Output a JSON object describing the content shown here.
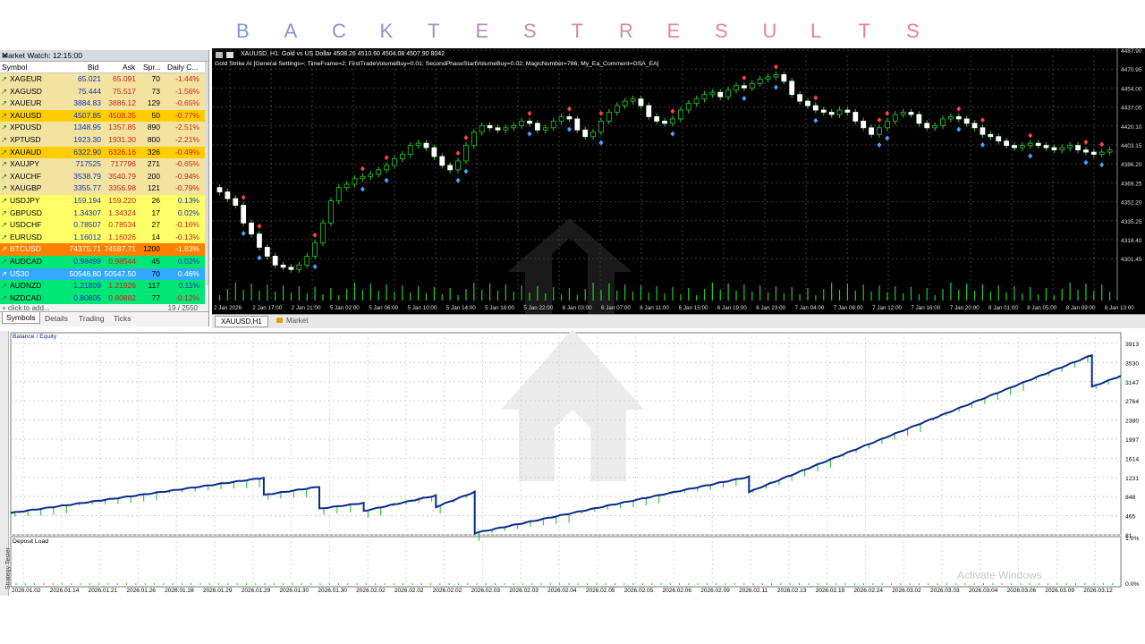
{
  "banner": {
    "letters": [
      "B",
      "A",
      "C",
      "K",
      "T",
      "E",
      "S",
      "T",
      "R",
      "E",
      "S",
      "U",
      "L",
      "T",
      "S"
    ],
    "colors": [
      "#7c9bd3",
      "#8596d0",
      "#8c92cc",
      "#9a8ec8",
      "#a98cc4",
      "#b88ac0",
      "#c48abc",
      "#ce88b6",
      "#d688b0",
      "#de86a8",
      "#e484a2",
      "#e8829c",
      "#ec8096",
      "#ef7e90",
      "#f27c8a"
    ]
  },
  "market_watch": {
    "title": "Market Watch: 12:15:00",
    "close": "✕",
    "headers": {
      "symbol": "Symbol",
      "bid": "Bid",
      "ask": "Ask",
      "spread": "Spr...",
      "change": "Daily C..."
    },
    "rows": [
      {
        "symbol": "XAGEUR",
        "bid": "65.021",
        "ask": "65.091",
        "spread": "70",
        "change": "-1.44%",
        "bg": "#f3e3a1",
        "dir": "up"
      },
      {
        "symbol": "XAGUSD",
        "bid": "75.444",
        "ask": "75.517",
        "spread": "73",
        "change": "-1.56%",
        "bg": "#f3e3a1",
        "dir": "up"
      },
      {
        "symbol": "XAUEUR",
        "bid": "3884.83",
        "ask": "3886.12",
        "spread": "129",
        "change": "-0.65%",
        "bg": "#f3e3a1",
        "dir": "up"
      },
      {
        "symbol": "XAUUSD",
        "bid": "4507.85",
        "ask": "4508.35",
        "spread": "50",
        "change": "-0.77%",
        "bg": "#ffcc00",
        "dir": "up"
      },
      {
        "symbol": "XPDUSD",
        "bid": "1348.95",
        "ask": "1357.85",
        "spread": "890",
        "change": "-2.51%",
        "bg": "#f3e3a1",
        "dir": "up"
      },
      {
        "symbol": "XPTUSD",
        "bid": "1923.30",
        "ask": "1931.30",
        "spread": "800",
        "change": "-2.21%",
        "bg": "#f3e3a1",
        "dir": "up"
      },
      {
        "symbol": "XAUAUD",
        "bid": "6322.90",
        "ask": "6326.16",
        "spread": "326",
        "change": "-0.49%",
        "bg": "#ffcc00",
        "dir": "up"
      },
      {
        "symbol": "XAUJPY",
        "bid": "717525",
        "ask": "717796",
        "spread": "271",
        "change": "-0.65%",
        "bg": "#f3e3a1",
        "dir": "up"
      },
      {
        "symbol": "XAUCHF",
        "bid": "3538.79",
        "ask": "3540.79",
        "spread": "200",
        "change": "-0.94%",
        "bg": "#f3e3a1",
        "dir": "up"
      },
      {
        "symbol": "XAUGBP",
        "bid": "3355.77",
        "ask": "3356.98",
        "spread": "121",
        "change": "-0.79%",
        "bg": "#f3e3a1",
        "dir": "up"
      },
      {
        "symbol": "USDJPY",
        "bid": "159.194",
        "ask": "159.220",
        "spread": "26",
        "change": "0.13%",
        "bg": "#ffff66",
        "dir": "up"
      },
      {
        "symbol": "GBPUSD",
        "bid": "1.34307",
        "ask": "1.34324",
        "spread": "17",
        "change": "0.02%",
        "bg": "#ffff66",
        "dir": "up"
      },
      {
        "symbol": "USDCHF",
        "bid": "0.78507",
        "ask": "0.78534",
        "spread": "27",
        "change": "-0.16%",
        "bg": "#ffff66",
        "dir": "up"
      },
      {
        "symbol": "EURUSD",
        "bid": "1.16012",
        "ask": "1.16026",
        "spread": "14",
        "change": "-0.13%",
        "bg": "#ffff66",
        "dir": "up"
      },
      {
        "symbol": "BTCUSD",
        "bid": "74375.71",
        "ask": "74587.71",
        "spread": "1200",
        "change": "-1.83%",
        "bg": "#ff8000",
        "dir": "up"
      },
      {
        "symbol": "AUDCAD",
        "bid": "0.98499",
        "ask": "0.98544",
        "spread": "45",
        "change": "0.02%",
        "bg": "#00e676",
        "dir": "up"
      },
      {
        "symbol": "US30",
        "bid": "50546.80",
        "ask": "50547.50",
        "spread": "70",
        "change": "0.46%",
        "bg": "#33aaff",
        "dir": "up"
      },
      {
        "symbol": "AUDNZD",
        "bid": "1.21809",
        "ask": "1.21926",
        "spread": "117",
        "change": "0.11%",
        "bg": "#00e676",
        "dir": "up"
      },
      {
        "symbol": "NZDCAD",
        "bid": "0.80805",
        "ask": "0.80882",
        "spread": "77",
        "change": "-0.12%",
        "bg": "#00e676",
        "dir": "up"
      }
    ],
    "add_label": "+ click to add...",
    "count": "19 / 2550",
    "tabs": [
      "Symbols",
      "Details",
      "Trading",
      "Ticks"
    ]
  },
  "price_chart": {
    "info_line1": "XAUUSD, H1:  Gold vs US Dollar  4508.26  4510.60  4504.08  4507.90  8042",
    "info_line2": "Gold Strike AI [General Settings=; TimeFrame=2; FirstTradeVolumeBuy=0.01; SecondPhaseStartVolumeBuy=0.02; MagicNumber=786; My_Ea_Comment=GSA_EA]",
    "y_labels": [
      "4487.90",
      "4470.95",
      "4454.00",
      "4437.05",
      "4420.10",
      "4403.15",
      "4386.20",
      "4369.25",
      "4352.20",
      "4335.25",
      "4318.40",
      "4301.45"
    ],
    "x_labels": [
      "2 Jan 2026",
      "2 Jan 17:00",
      "2 Jan 21:00",
      "5 Jan 02:00",
      "5 Jan 06:00",
      "5 Jan 10:00",
      "5 Jan 14:00",
      "5 Jan 18:00",
      "5 Jan 22:00",
      "6 Jan 03:00",
      "6 Jan 07:00",
      "6 Jan 11:00",
      "6 Jan 15:00",
      "6 Jan 19:00",
      "6 Jan 23:00",
      "7 Jan 04:00",
      "7 Jan 08:00",
      "7 Jan 12:00",
      "7 Jan 16:00",
      "7 Jan 20:00",
      "8 Jan 01:00",
      "8 Jan 05:00",
      "8 Jan 09:00",
      "8 Jan 13:00"
    ],
    "closes": [
      4388,
      4382,
      4376,
      4360,
      4350,
      4338,
      4330,
      4322,
      4320,
      4318,
      4322,
      4330,
      4342,
      4360,
      4380,
      4392,
      4395,
      4400,
      4402,
      4404,
      4408,
      4412,
      4418,
      4422,
      4430,
      4432,
      4428,
      4420,
      4412,
      4408,
      4416,
      4430,
      4442,
      4448,
      4446,
      4444,
      4446,
      4448,
      4452,
      4450,
      4444,
      4446,
      4452,
      4456,
      4454,
      4444,
      4438,
      4442,
      4452,
      4460,
      4466,
      4470,
      4472,
      4466,
      4456,
      4452,
      4450,
      4454,
      4462,
      4468,
      4472,
      4476,
      4478,
      4474,
      4480,
      4484,
      4482,
      4486,
      4490,
      4492,
      4494,
      4488,
      4476,
      4470,
      4466,
      4462,
      4460,
      4458,
      4462,
      4460,
      4452,
      4446,
      4440,
      4446,
      4452,
      4458,
      4460,
      4458,
      4450,
      4446,
      4448,
      4454,
      4456,
      4454,
      4450,
      4446,
      4440,
      4438,
      4434,
      4430,
      4428,
      4430,
      4432,
      4430,
      4428,
      4426,
      4428,
      4430,
      4426,
      4424,
      4422,
      4424,
      4426
    ],
    "tabs": [
      "XAUUSD,H1",
      "Market"
    ]
  },
  "tester": {
    "label_top": "Balance / Equity",
    "label_bottom": "Deposit Load",
    "side_label": "Strategy Tester",
    "y_labels": [
      "3913",
      "3530",
      "3147",
      "2764",
      "2380",
      "1997",
      "1614",
      "1231",
      "848",
      "465",
      "81"
    ],
    "y_labels2": [
      "1.0%",
      "0.0%"
    ],
    "x_labels": [
      "2026.01.02",
      "2026.01.14",
      "2026.01.21",
      "2026.01.26",
      "2026.01.28",
      "2026.01.29",
      "2026.01.29",
      "2026.01.30",
      "2026.01.30",
      "2026.02.02",
      "2026.02.02",
      "2026.02.02",
      "2026.02.03",
      "2026.02.03",
      "2026.02.04",
      "2026.02.05",
      "2026.02.05",
      "2026.02.06",
      "2026.02.09",
      "2026.02.11",
      "2026.02.13",
      "2026.02.19",
      "2026.02.24",
      "2026.03.02",
      "2026.03.03",
      "2026.03.04",
      "2026.03.06",
      "2026.03.09",
      "2026.03.12"
    ],
    "balance_segments": [
      [
        [
          0,
          520
        ],
        [
          0.228,
          1225
        ]
      ],
      [
        [
          0.228,
          880
        ],
        [
          0.278,
          1045
        ]
      ],
      [
        [
          0.278,
          605
        ],
        [
          0.318,
          720
        ]
      ],
      [
        [
          0.318,
          560
        ],
        [
          0.383,
          870
        ]
      ],
      [
        [
          0.383,
          640
        ],
        [
          0.418,
          942
        ]
      ],
      [
        [
          0.418,
          118
        ],
        [
          0.665,
          1245
        ]
      ],
      [
        [
          0.665,
          940
        ],
        [
          0.974,
          3680
        ]
      ],
      [
        [
          0.974,
          3045
        ],
        [
          1.0,
          3265
        ]
      ]
    ],
    "colors": {
      "balance": "#0b2a8c",
      "equity": "#1ecb2c"
    }
  },
  "watermark": {
    "text": "Activate Windows"
  }
}
